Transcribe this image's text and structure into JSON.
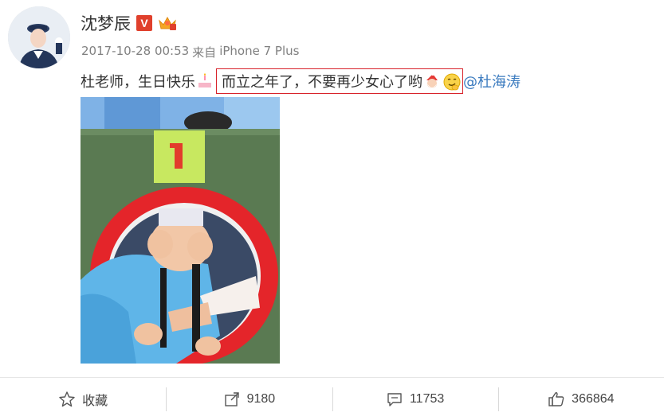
{
  "user": {
    "name": "沈梦辰",
    "verified_badge": "V",
    "timestamp": "2017-10-28 00:53",
    "source_prefix": "来自",
    "source_device": "iPhone 7 Plus"
  },
  "post": {
    "text_part1": "杜老师，生日快乐",
    "text_highlighted": "而立之年了，不要再少女心了哟",
    "mention": "@杜海涛",
    "emojis": [
      "cake-emoji",
      "santa-emoji",
      "smirk-emoji"
    ]
  },
  "photo": {
    "sign_number": "1"
  },
  "footer": {
    "favorite_label": "收藏",
    "share_count": "9180",
    "comment_count": "11753",
    "like_count": "366864"
  },
  "colors": {
    "highlight_border": "#d8222a",
    "mention": "#3b7bbf",
    "verified": "#e0402c",
    "meta_text": "#808080"
  },
  "icons": [
    "star-icon",
    "share-icon",
    "comment-icon",
    "thumb-up-icon"
  ]
}
